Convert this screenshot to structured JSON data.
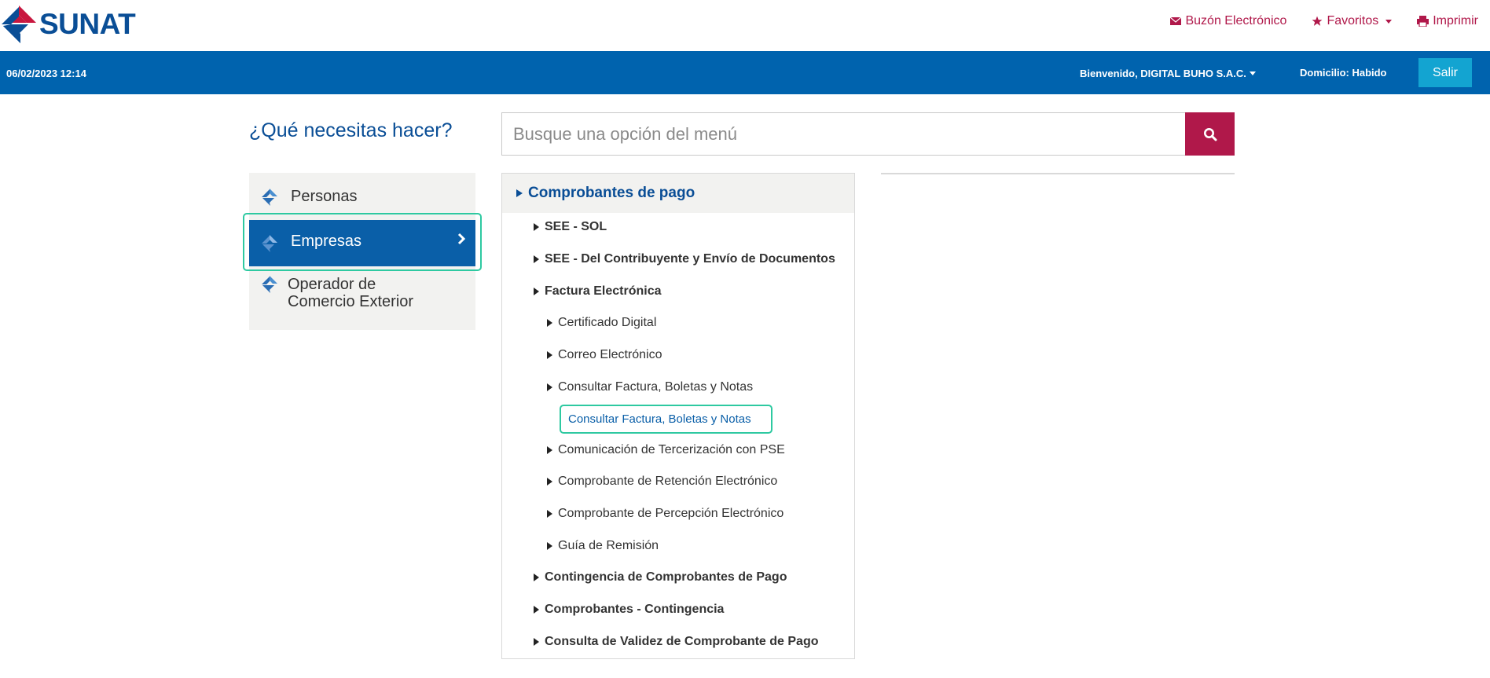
{
  "header": {
    "logo_text": "SUNAT",
    "links": {
      "buzon": "Buzón Electrónico",
      "favoritos": "Favoritos",
      "imprimir": "Imprimir"
    },
    "icons": {
      "buzon": "envelope-icon",
      "favoritos": "star-icon",
      "imprimir": "printer-icon"
    }
  },
  "bar": {
    "datetime": "06/02/2023 12:14",
    "welcome": "Bienvenido, DIGITAL BUHO S.A.C.",
    "domicilio": "Domicilio: Habido",
    "salir": "Salir"
  },
  "search": {
    "question": "¿Qué necesitas hacer?",
    "placeholder": "Busque una opción del menú",
    "icon": "search-icon"
  },
  "left_menu": {
    "items": [
      {
        "label": "Personas"
      },
      {
        "label": "Empresas",
        "selected": true
      },
      {
        "label_line1": "Operador de",
        "label_line2": "Comercio Exterior"
      }
    ]
  },
  "tree": {
    "title": "Comprobantes de pago",
    "items": [
      {
        "label": "SEE - SOL"
      },
      {
        "label": "SEE - Del Contribuyente y Envío de Documentos"
      },
      {
        "label": "Factura Electrónica"
      },
      {
        "label": "Certificado Digital"
      },
      {
        "label": "Correo Electrónico"
      },
      {
        "label": "Consultar Factura, Boletas y Notas"
      },
      {
        "label": "Consultar Factura, Boletas y Notas"
      },
      {
        "label": "Comunicación de Tercerización con PSE"
      },
      {
        "label": "Comprobante de Retención Electrónico"
      },
      {
        "label": "Comprobante de Percepción Electrónico"
      },
      {
        "label": "Guía de Remisión"
      },
      {
        "label": "Contingencia de Comprobantes de Pago"
      },
      {
        "label": "Comprobantes - Contingencia"
      },
      {
        "label": "Consulta de Validez de Comprobante de Pago"
      }
    ]
  },
  "colors": {
    "brand_blue": "#0063ae",
    "brand_red": "#b0184a",
    "salir": "#13a4d1",
    "highlight": "#2ec9a1"
  }
}
